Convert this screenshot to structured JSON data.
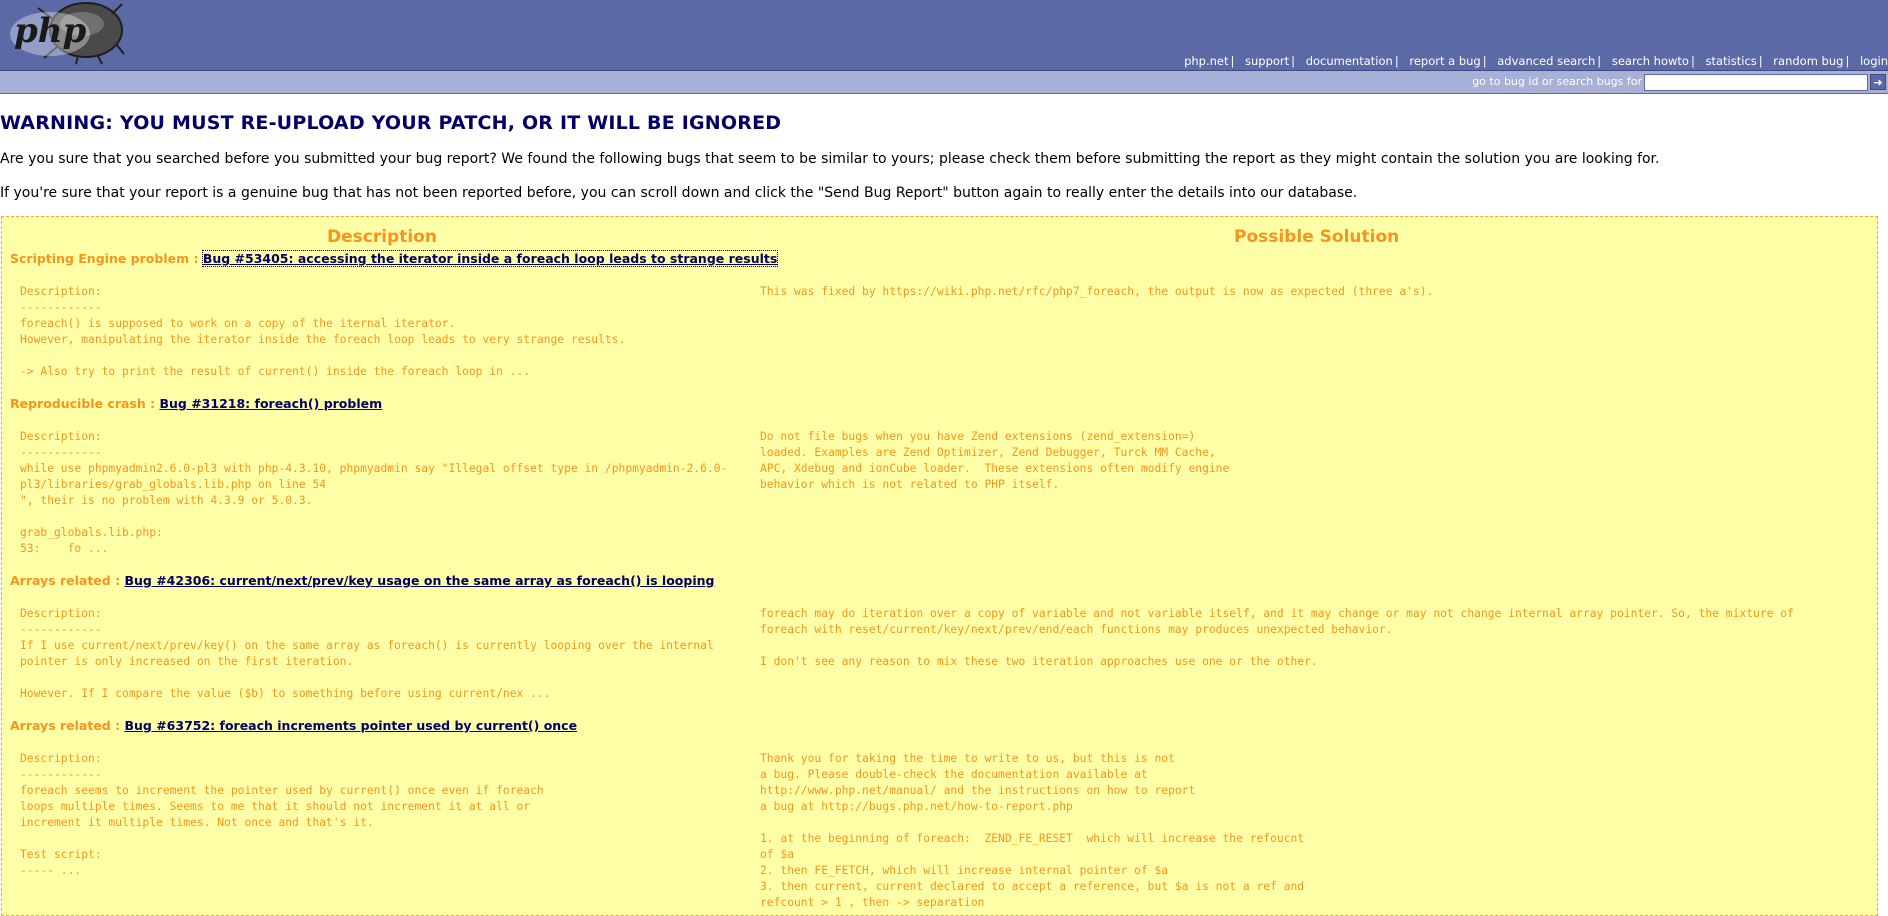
{
  "nav": {
    "links": [
      "php.net",
      "support",
      "documentation",
      "report a bug",
      "advanced search",
      "search howto",
      "statistics",
      "random bug",
      "login"
    ]
  },
  "search": {
    "label": "go to bug id or search bugs for",
    "value": "",
    "go_glyph": "➜"
  },
  "warning": "WARNING: YOU MUST RE-UPLOAD YOUR PATCH, OR IT WILL BE IGNORED",
  "intro": [
    "Are you sure that you searched before you submitted your bug report? We found the following bugs that seem to be similar to yours; please check them before submitting the report as they might contain the solution you are looking for.",
    "If you're sure that your report is a genuine bug that has not been reported before, you can scroll down and click the \"Send Bug Report\" button again to really enter the details into our database."
  ],
  "columns": {
    "description": "Description",
    "solution": "Possible Solution"
  },
  "bugs": [
    {
      "category": "Scripting Engine problem :",
      "link": "Bug #53405: accessing the iterator inside a foreach loop leads to strange results",
      "description": "Description:\n------------\nforeach() is supposed to work on a copy of the iternal iterator.\nHowever, manipulating the iterator inside the foreach loop leads to very strange results.\n\n-> Also try to print the result of current() inside the foreach loop in ...",
      "solution": "This was fixed by https://wiki.php.net/rfc/php7_foreach, the output is now as expected (three a's)."
    },
    {
      "category": "Reproducible crash :",
      "link": "Bug #31218: foreach() problem",
      "description": "Description:\n------------\nwhile use phpmyadmin2.6.0-pl3 with php-4.3.10, phpmyadmin say \"Illegal offset type in /phpmyadmin-2.6.0-\npl3/libraries/grab_globals.lib.php on line 54\n\", their is no problem with 4.3.9 or 5.0.3.\n\ngrab_globals.lib.php:\n53:    fo ...",
      "solution": "Do not file bugs when you have Zend extensions (zend_extension=)\nloaded. Examples are Zend Optimizer, Zend Debugger, Turck MM Cache,\nAPC, Xdebug and ionCube loader.  These extensions often modify engine\nbehavior which is not related to PHP itself."
    },
    {
      "category": "Arrays related :",
      "link": "Bug #42306: current/next/prev/key usage on the same array as foreach() is looping",
      "description": "Description:\n------------\nIf I use current/next/prev/key() on the same array as foreach() is currently looping over the internal\npointer is only increased on the first iteration.\n\nHowever. If I compare the value ($b) to something before using current/nex ...",
      "solution": "foreach may do iteration over a copy of variable and not variable itself, and it may change or may not change internal array pointer. So, the mixture of\nforeach with reset/current/key/next/prev/end/each functions may produces unexpected behavior.\n\nI don't see any reason to mix these two iteration approaches use one or the other."
    },
    {
      "category": "Arrays related :",
      "link": "Bug #63752: foreach increments pointer used by current() once",
      "description": "Description:\n------------\nforeach seems to increment the pointer used by current() once even if foreach\nloops multiple times. Seems to me that it should not increment it at all or\nincrement it multiple times. Not once and that's it.\n\nTest script:\n----- ...",
      "solution": "Thank you for taking the time to write to us, but this is not\na bug. Please double-check the documentation available at\nhttp://www.php.net/manual/ and the instructions on how to report\na bug at http://bugs.php.net/how-to-report.php\n\n1. at the beginning of foreach:  ZEND_FE_RESET  which will increase the refoucnt\nof $a\n2. then FE_FETCH, which will increase internal pointer of $a\n3. then current, current declared to accept a reference, but $a is not a ref and\nrefcount > 1 , then -> separation"
    }
  ]
}
